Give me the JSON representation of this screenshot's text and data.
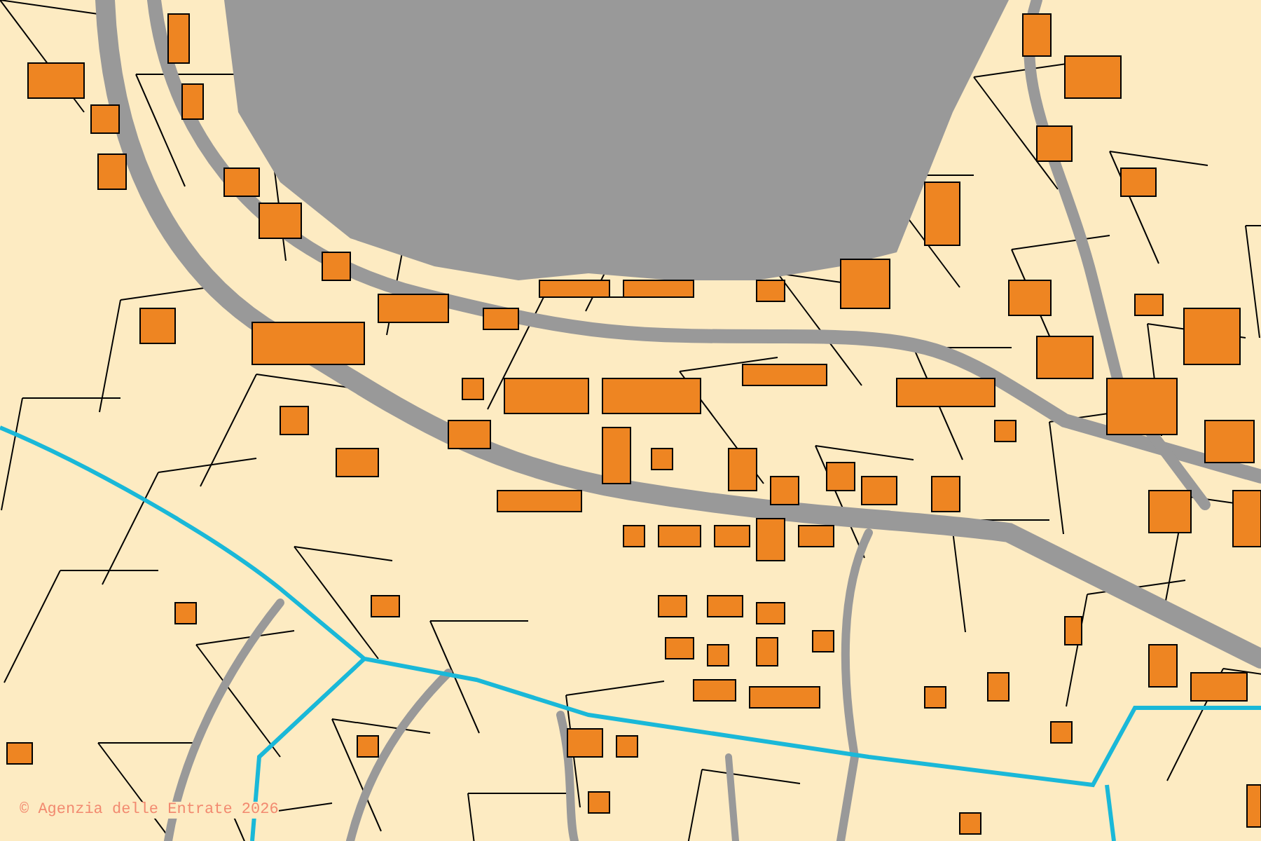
{
  "map": {
    "attribution": "© Agenzia delle Entrate 2026"
  }
}
